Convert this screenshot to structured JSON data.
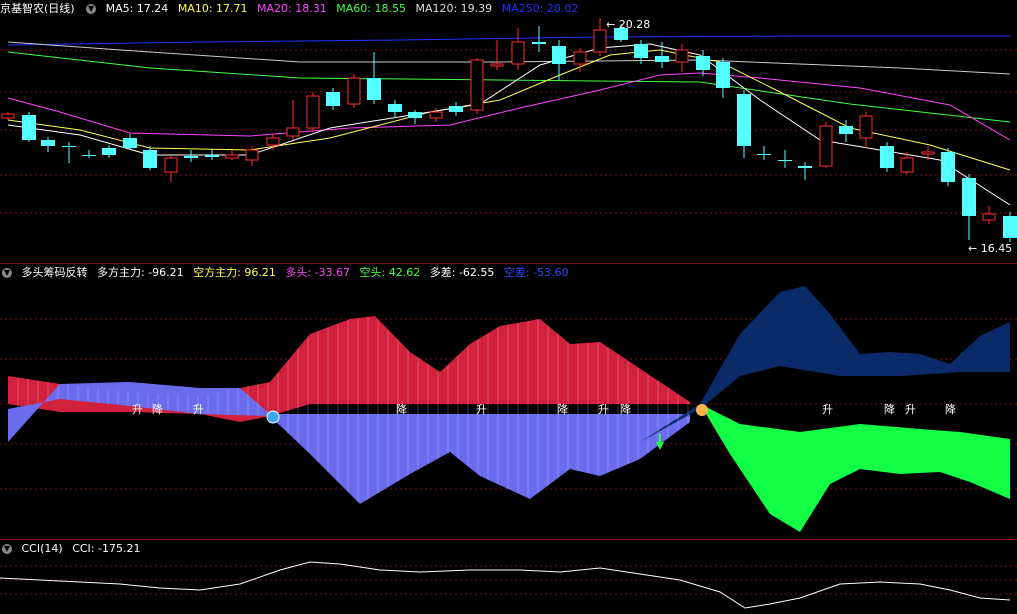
{
  "main_header": {
    "title": "京基智农(日线)",
    "ma5": "MA5: 17.24",
    "ma10": "MA10: 17.71",
    "ma20": "MA20: 18.31",
    "ma60": "MA60: 18.55",
    "ma120": "MA120: 19.39",
    "ma250": "MA250: 20.02"
  },
  "main_marks": {
    "high": "20.28",
    "low": "16.45"
  },
  "ind_header": {
    "title": "多头筹码反转",
    "v1": "多方主力: -96.21",
    "v2": "空方主力: 96.21",
    "v3": "多头: -33.67",
    "v4": "空头: 42.62",
    "v5": "多差: -62.55",
    "v6": "空差: -53.60"
  },
  "ind_labels": [
    "升",
    "降",
    "升",
    "降",
    "升",
    "降",
    "升",
    "降",
    "升",
    "降",
    "升",
    "降"
  ],
  "cci_header": {
    "title": "CCI(14)",
    "value": "CCI: -175.21"
  },
  "colors": {
    "up": "#ff3030",
    "down": "#54ffff",
    "ma5": "#ffffff",
    "ma10": "#ffff55",
    "ma20": "#ff44ff",
    "ma60": "#44ff44",
    "ma120": "#cccccc",
    "ma250": "#2233ff",
    "bull": "#d1213c",
    "bear": "#6b6bee",
    "navy": "#0b2a6a",
    "green": "#11ff44"
  }
}
